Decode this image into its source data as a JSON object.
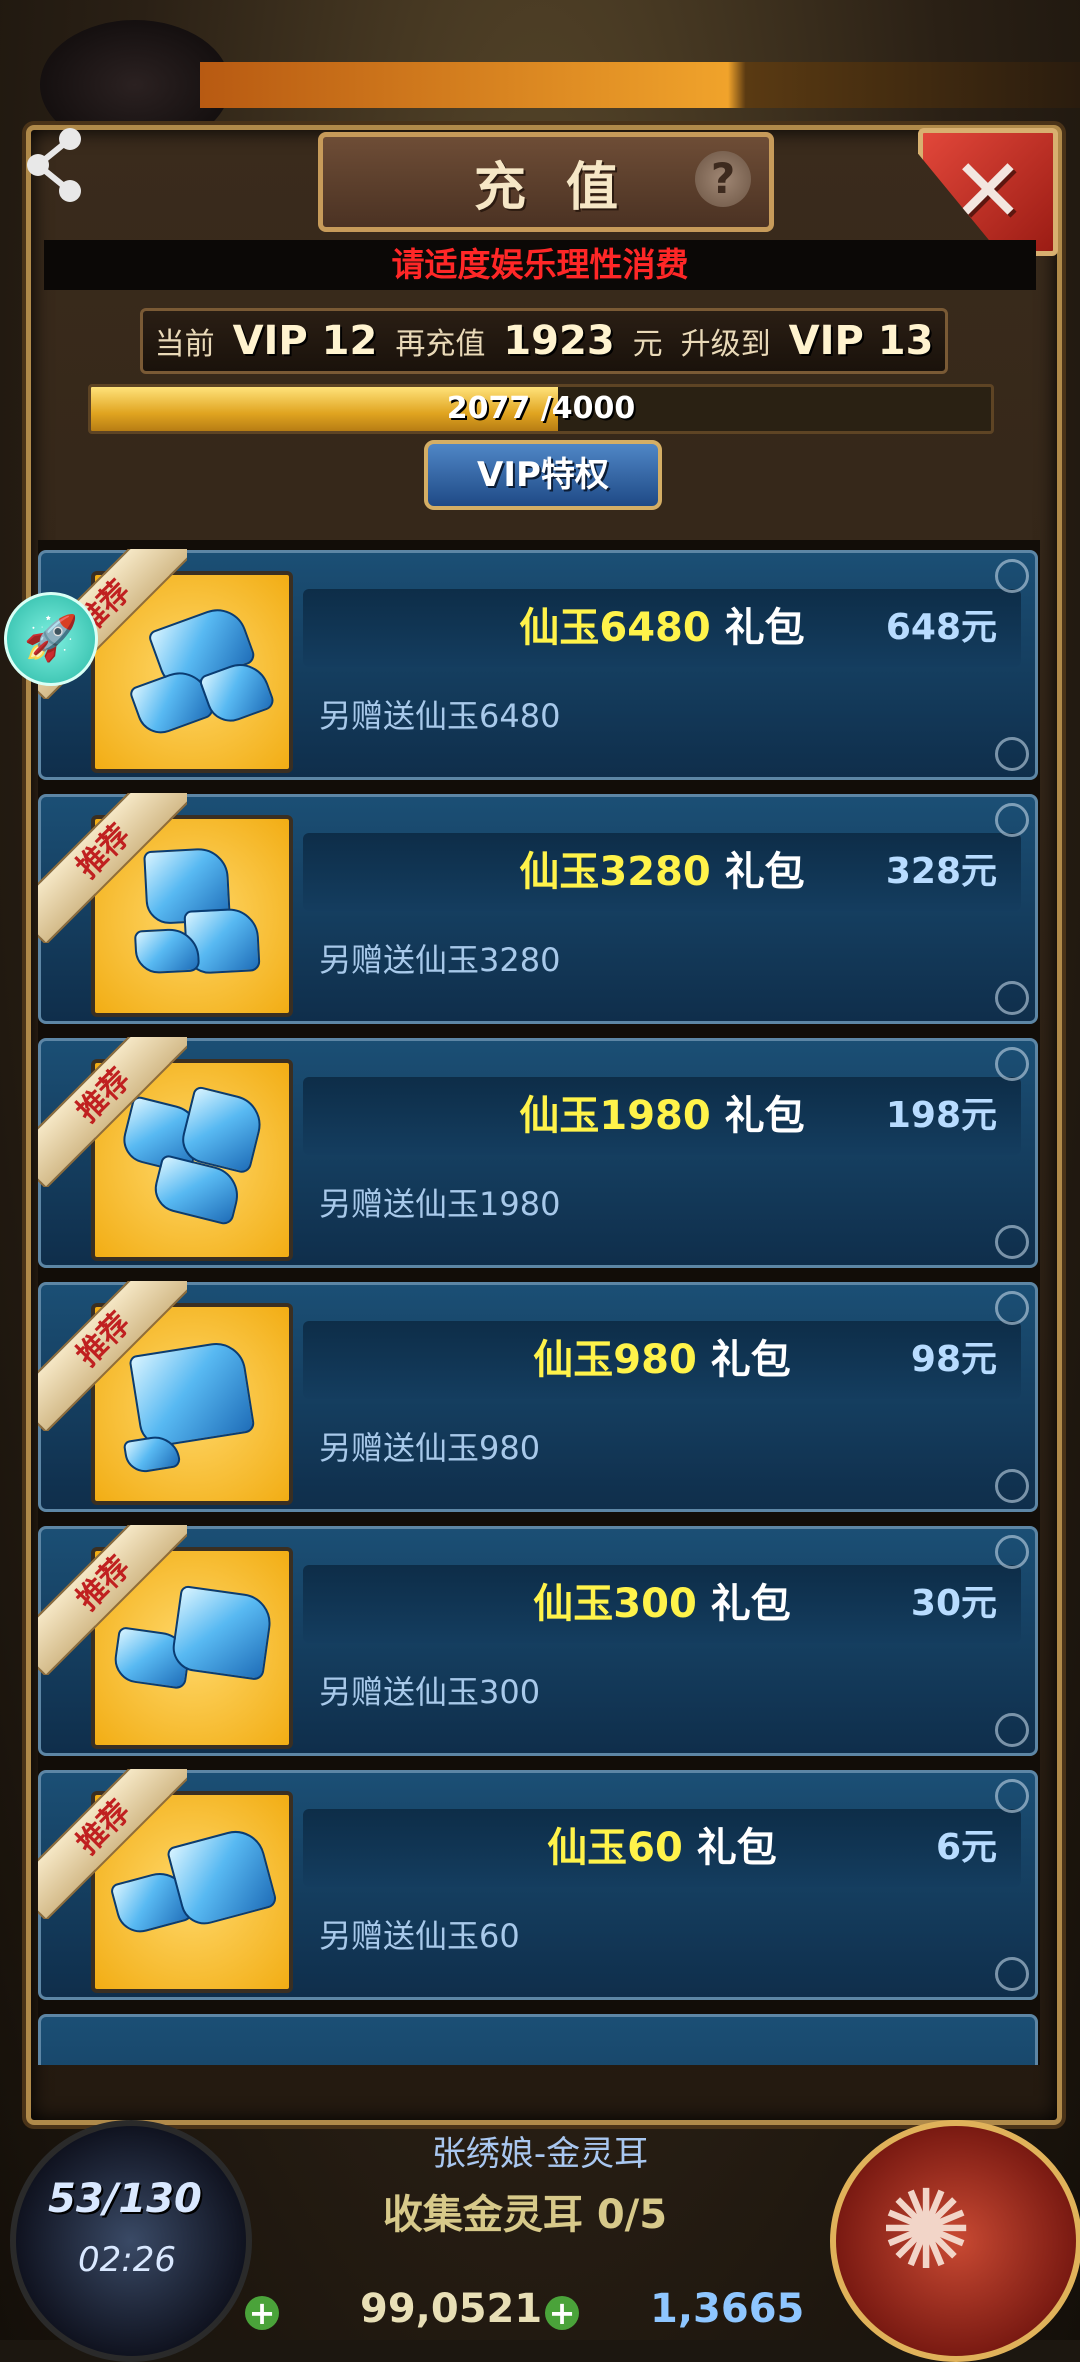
{
  "dialog": {
    "title": "充值",
    "help_icon": "?",
    "notice": "请适度娱乐理性消费",
    "vip": {
      "current_label": "当前",
      "current_level": "VIP 12",
      "recharge_label": "再充值",
      "recharge_amount": "1923",
      "currency": "元",
      "upgrade_label": "升级到",
      "next_level": "VIP 13"
    },
    "progress": {
      "current": 2077,
      "total": 4000,
      "text": "2077 /4000",
      "fraction": 0.5193
    },
    "privilege_button": "VIP特权",
    "packages": [
      {
        "amount": "仙玉6480",
        "suffix": "礼包",
        "price": "648元",
        "bonus": "另赠送仙玉6480",
        "tag": "推荐",
        "icon": "treasure-chest-icon"
      },
      {
        "amount": "仙玉3280",
        "suffix": "礼包",
        "price": "328元",
        "bonus": "另赠送仙玉3280",
        "tag": "推荐",
        "icon": "gem-sack-icon"
      },
      {
        "amount": "仙玉1980",
        "suffix": "礼包",
        "price": "198元",
        "bonus": "另赠送仙玉1980",
        "tag": "推荐",
        "icon": "gem-pile-cloth-icon"
      },
      {
        "amount": "仙玉980",
        "suffix": "礼包",
        "price": "98元",
        "bonus": "另赠送仙玉980",
        "tag": "推荐",
        "icon": "gem-pile-icon"
      },
      {
        "amount": "仙玉300",
        "suffix": "礼包",
        "price": "30元",
        "bonus": "另赠送仙玉300",
        "tag": "推荐",
        "icon": "gem-few-icon"
      },
      {
        "amount": "仙玉60",
        "suffix": "礼包",
        "price": "6元",
        "bonus": "另赠送仙玉60",
        "tag": "推荐",
        "icon": "gem-small-icon"
      }
    ]
  },
  "hud": {
    "stamina": "53/130",
    "timer": "02:26",
    "quest_title": "张绣娘-金灵耳",
    "quest_progress": "收集金灵耳 0/5",
    "gold": "99,0521",
    "jade": "1,3665"
  },
  "colors": {
    "accent_yellow": "#fff34a",
    "notice_red": "#ff2727",
    "card_blue": "#1b4f75"
  }
}
